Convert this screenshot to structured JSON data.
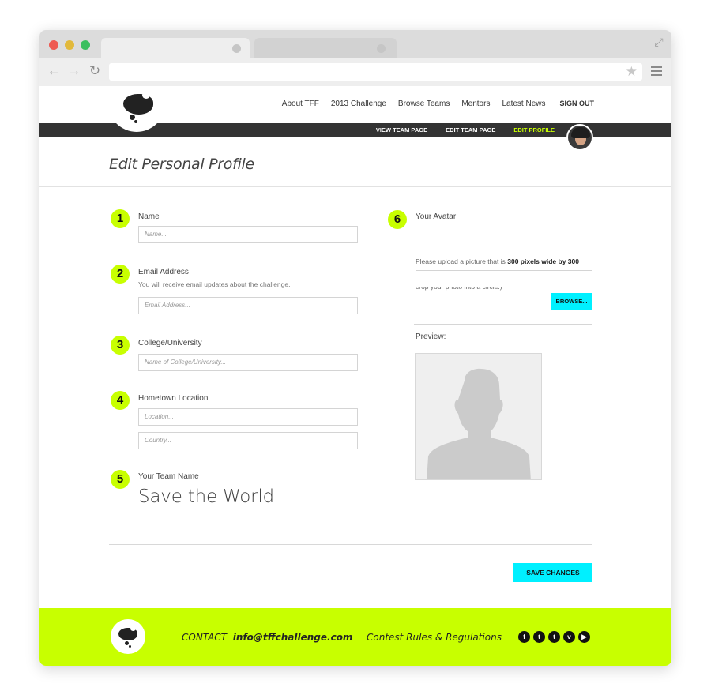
{
  "nav": {
    "items": [
      "About TFF",
      "2013 Challenge",
      "Browse Teams",
      "Mentors",
      "Latest News"
    ],
    "signout": "SIGN OUT"
  },
  "subnav": {
    "view_team": "VIEW TEAM PAGE",
    "edit_team": "EDIT TEAM PAGE",
    "edit_profile": "EDIT PROFILE"
  },
  "page": {
    "title": "Edit Personal Profile"
  },
  "form": {
    "name": {
      "number": "1",
      "label": "Name",
      "placeholder": "Name..."
    },
    "email": {
      "number": "2",
      "label": "Email Address",
      "help": "You will receive email updates about the challenge.",
      "placeholder": "Email Address..."
    },
    "college": {
      "number": "3",
      "label": "College/University",
      "placeholder": "Name of College/University..."
    },
    "hometown": {
      "number": "4",
      "label": "Hometown Location",
      "location_placeholder": "Location...",
      "country_placeholder": "Country..."
    },
    "team": {
      "number": "5",
      "label": "Your Team Name",
      "value": "Save the World"
    },
    "avatar": {
      "number": "6",
      "label": "Your Avatar",
      "help_prefix": "Please upload a picture that is ",
      "help_bold": "300 pixels wide by 300 pixels tall",
      "help_suffix": ". A square will work best for your avatar (we will crop your photo into a circle.)",
      "browse_label": "BROWSE...",
      "preview_label": "Preview:"
    },
    "save_label": "SAVE CHANGES"
  },
  "footer": {
    "contact_label": "CONTACT",
    "contact_email": "info@tffchallenge.com",
    "rules": "Contest Rules & Regulations",
    "social": [
      {
        "icon": "facebook-icon",
        "glyph": "f"
      },
      {
        "icon": "twitter-icon",
        "glyph": "t"
      },
      {
        "icon": "tumblr-icon",
        "glyph": "t"
      },
      {
        "icon": "vimeo-icon",
        "glyph": "v"
      },
      {
        "icon": "youtube-icon",
        "glyph": "▶"
      }
    ]
  },
  "colors": {
    "accent": "#c8ff00",
    "button": "#00f0ff",
    "bar": "#333333"
  }
}
